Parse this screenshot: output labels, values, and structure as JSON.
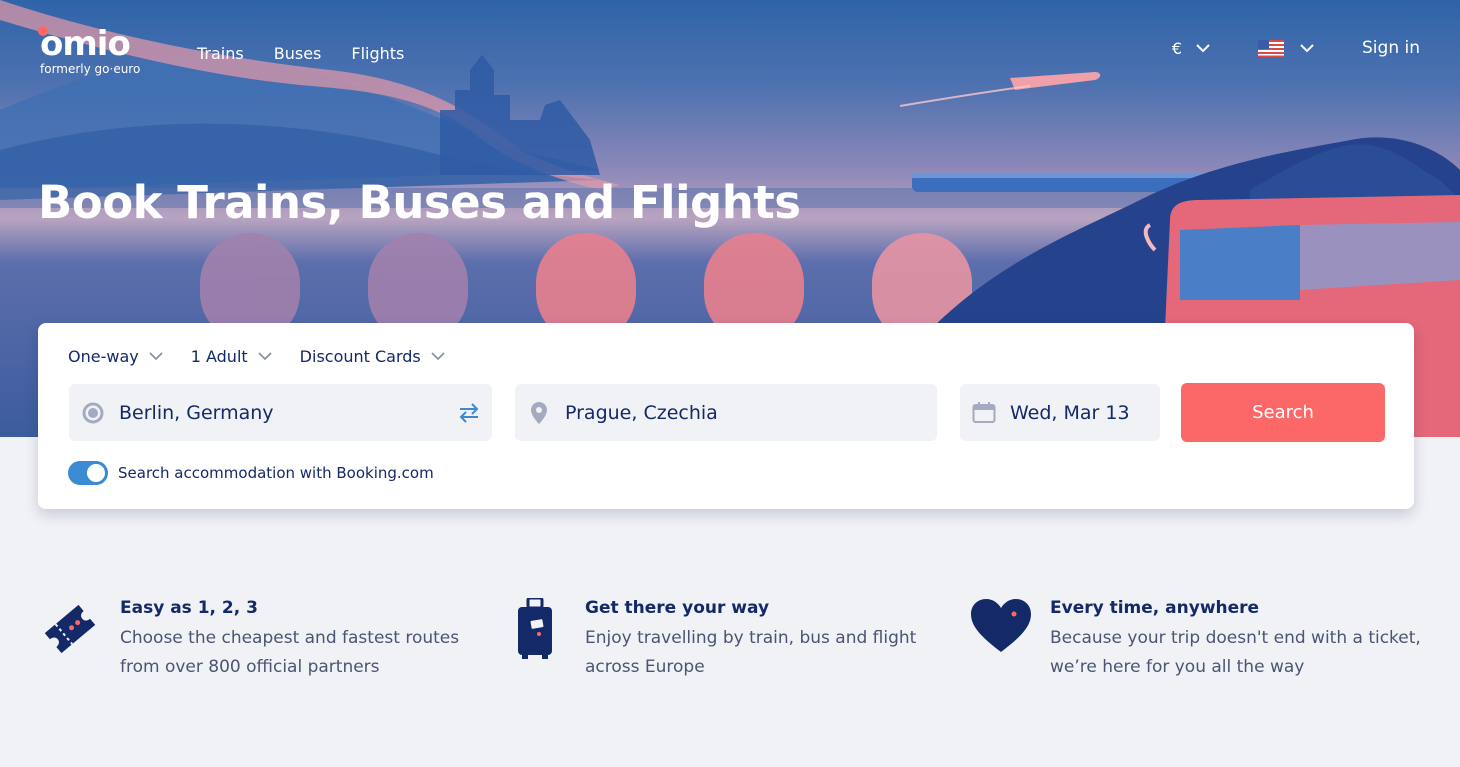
{
  "brand": {
    "logo": "omio",
    "tagline": "formerly go·euro",
    "accent": "#fc6767",
    "navy": "#132968"
  },
  "nav": {
    "trains": "Trains",
    "buses": "Buses",
    "flights": "Flights"
  },
  "header": {
    "currency": "€",
    "language_flag": "us-flag-icon",
    "sign_in": "Sign in"
  },
  "hero": {
    "title": "Book Trains, Buses and Flights"
  },
  "search": {
    "trip_type": "One-way",
    "passengers": "1 Adult",
    "discount": "Discount Cards",
    "from": "Berlin, Germany",
    "to": "Prague, Czechia",
    "date": "Wed, Mar 13",
    "button": "Search",
    "accommodation_label": "Search accommodation with Booking.com",
    "accommodation_enabled": true
  },
  "features": [
    {
      "icon": "ticket-icon",
      "title": "Easy as 1, 2, 3",
      "text": "Choose the cheapest and fastest routes from over 800 official partners"
    },
    {
      "icon": "suitcase-icon",
      "title": "Get there your way",
      "text": "Enjoy travelling by train, bus and flight across Europe"
    },
    {
      "icon": "heart-icon",
      "title": "Every time, anywhere",
      "text": "Because your trip doesn't end with a ticket, we’re here for you all the way"
    }
  ]
}
